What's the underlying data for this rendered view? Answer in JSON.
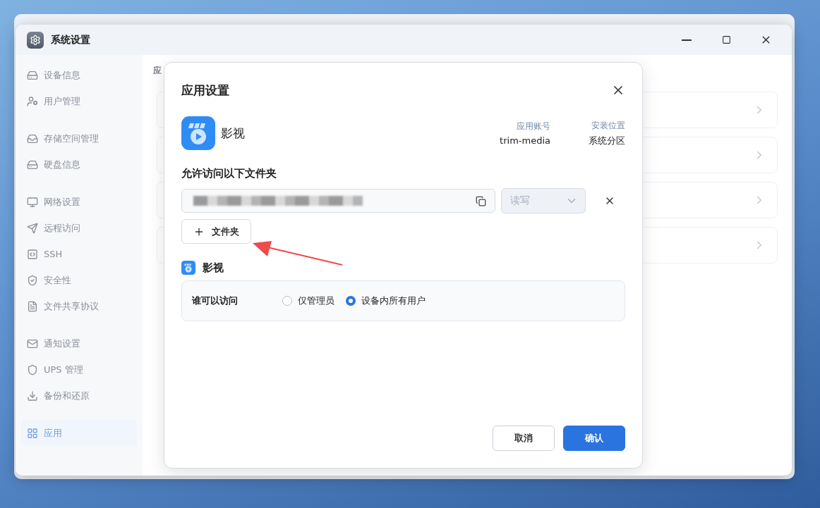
{
  "window": {
    "title": "系统设置"
  },
  "sidebar": {
    "groups": [
      [
        {
          "label": "设备信息",
          "selected": false
        },
        {
          "label": "用户管理",
          "selected": false
        }
      ],
      [
        {
          "label": "存储空间管理",
          "selected": false
        },
        {
          "label": "硬盘信息",
          "selected": false
        }
      ],
      [
        {
          "label": "网络设置",
          "selected": false
        },
        {
          "label": "远程访问",
          "selected": false
        },
        {
          "label": "SSH",
          "selected": false
        },
        {
          "label": "安全性",
          "selected": false
        },
        {
          "label": "文件共享协议",
          "selected": false
        }
      ],
      [
        {
          "label": "通知设置",
          "selected": false
        },
        {
          "label": "UPS 管理",
          "selected": false
        },
        {
          "label": "备份和还原",
          "selected": false
        }
      ],
      [
        {
          "label": "应用",
          "selected": true
        }
      ]
    ]
  },
  "content": {
    "heading": "应"
  },
  "dialog": {
    "title": "应用设置",
    "app": {
      "name": "影视",
      "meta": [
        {
          "label": "应用账号",
          "value": "trim-media"
        },
        {
          "label": "安装位置",
          "value": "系统分区"
        }
      ]
    },
    "folders_heading": "允许访问以下文件夹",
    "folders": [
      {
        "permission": "读写",
        "disabled": true
      }
    ],
    "add_folder_button": "文件夹",
    "section": {
      "title": "影视",
      "access_label": "谁可以访问",
      "options": [
        {
          "label": "仅管理员",
          "selected": false
        },
        {
          "label": "设备内所有用户",
          "selected": true
        }
      ]
    },
    "buttons": [
      {
        "label": "取消",
        "kind": "secondary"
      },
      {
        "label": "确认",
        "kind": "primary"
      }
    ]
  }
}
